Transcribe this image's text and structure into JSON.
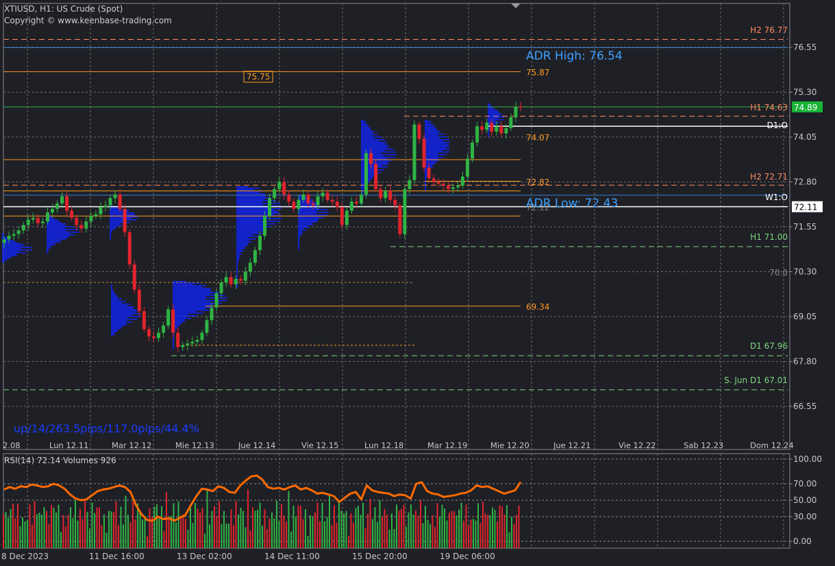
{
  "header": {
    "symbol_line": "XTIUSD, H1:  US Crude (Spot)",
    "copyright": "Copyright © www.keenbase-trading.com"
  },
  "overlays": {
    "adr_high": "ADR High: 76.54",
    "adr_low": "ADR Low: 72.43",
    "stats": "up/14/263.5pips/117.0pips/44.4%"
  },
  "colors": {
    "background": "#1f2026",
    "grid": "#6e6e6e",
    "bull": "#2fb344",
    "bear": "#e0242c",
    "profile": "#1024f0",
    "rsi": "#ff6a00",
    "orange_level": "#ff9a1f",
    "salmon_level": "#ff8a60",
    "green_level": "#7fd87f",
    "adr": "#3da0ff",
    "white_level": "#ffffff",
    "price_label_bg": "#19b436"
  },
  "price_axis": {
    "ticks": [
      "76.55",
      "75.30",
      "74.05",
      "72.80",
      "71.55",
      "70.30",
      "69.05",
      "67.80",
      "66.55"
    ],
    "current_price": "74.89",
    "white_label": "72.11"
  },
  "time_axis": {
    "labels": [
      "2.08",
      "Lun 12.11",
      "Mar 12.12",
      "Mie 12.13",
      "Jue 12.14",
      "Vie 12.15",
      "Lun 12.18",
      "Mar 12.19",
      "Mie 12.20",
      "Jue 12.21",
      "Vie 12.22",
      "Sab 12.23",
      "Dom 12.24"
    ]
  },
  "levels": {
    "h2_high": "H2 76.77",
    "orange_7587": "75.87",
    "boxed_7575": "75.75",
    "h1_high": "H1 74.63",
    "d1_open": "D1:O",
    "orange_7407": "74.07",
    "orange_7282": "72.82",
    "h2_low": "H2 72.71",
    "w1_open": "W1:O",
    "behind_adr_low": "72.12",
    "h1_low": "H1 71.00",
    "level_70": "70.0",
    "orange_6934": "69.34",
    "d1_low": "D1 67.96",
    "s_jun_d1": "S. Jun D1 67.01"
  },
  "rsi_panel": {
    "title": "RSI(14) 72.14 Volumes 926",
    "ticks": [
      "100.00",
      "70.00",
      "50.00",
      "30.00",
      "0.00"
    ],
    "time_labels": [
      "8 Dec 2023",
      "11 Dec 16:00",
      "13 Dec 02:00",
      "14 Dec 11:00",
      "15 Dec 20:00",
      "19 Dec 06:00"
    ]
  },
  "chart_data": {
    "type": "candlestick",
    "symbol": "XTIUSD",
    "timeframe": "H1",
    "y_range": [
      65.9,
      77.25
    ],
    "price_ticks": [
      76.55,
      75.3,
      74.05,
      72.8,
      71.55,
      70.3,
      69.05,
      67.8,
      66.55
    ],
    "closes": [
      71.2,
      71.3,
      71.35,
      71.45,
      71.6,
      71.75,
      71.8,
      71.65,
      71.7,
      71.95,
      72.05,
      72.2,
      72.4,
      72.0,
      71.8,
      71.6,
      71.5,
      71.7,
      71.85,
      71.9,
      72.1,
      72.15,
      72.35,
      72.45,
      72.05,
      71.4,
      70.5,
      69.8,
      69.2,
      68.7,
      68.5,
      68.45,
      68.6,
      68.8,
      69.25,
      68.6,
      68.2,
      68.25,
      68.3,
      68.35,
      68.4,
      68.6,
      68.95,
      69.3,
      69.7,
      70.0,
      70.15,
      69.95,
      70.1,
      70.05,
      70.3,
      70.55,
      70.9,
      71.3,
      71.85,
      72.35,
      72.6,
      72.8,
      72.45,
      72.25,
      72.05,
      72.3,
      72.45,
      72.2,
      72.15,
      72.4,
      72.5,
      72.3,
      72.25,
      72.1,
      71.6,
      72.0,
      72.25,
      72.2,
      72.45,
      73.6,
      73.3,
      72.6,
      72.35,
      72.55,
      72.3,
      72.15,
      71.35,
      72.6,
      72.85,
      74.4,
      74.0,
      73.2,
      72.9,
      72.8,
      72.75,
      72.7,
      72.6,
      72.65,
      72.7,
      72.95,
      73.45,
      73.9,
      74.35,
      74.25,
      74.45,
      74.2,
      74.35,
      74.15,
      74.3,
      74.6,
      74.9,
      74.89
    ],
    "rsi": [
      63,
      66,
      64,
      67,
      66,
      69,
      68,
      66,
      67,
      70,
      68,
      64,
      57,
      52,
      50,
      51,
      56,
      61,
      63,
      64,
      66,
      68,
      66,
      60,
      44,
      33,
      26,
      25,
      30,
      27,
      28,
      25,
      29,
      32,
      44,
      55,
      64,
      63,
      61,
      67,
      65,
      60,
      59,
      68,
      74,
      79,
      80,
      75,
      66,
      64,
      65,
      63,
      66,
      68,
      63,
      65,
      62,
      58,
      59,
      57,
      55,
      48,
      53,
      58,
      60,
      51,
      68,
      62,
      60,
      59,
      58,
      55,
      57,
      56,
      52,
      70,
      72,
      61,
      58,
      57,
      54,
      55,
      56,
      58,
      59,
      62,
      68,
      66,
      67,
      64,
      61,
      58,
      60,
      62,
      72.14
    ],
    "rsi_ticks": [
      100,
      70,
      50,
      30,
      0
    ],
    "current_price": 74.89,
    "current_rsi": 72.14,
    "current_volume": 926
  }
}
